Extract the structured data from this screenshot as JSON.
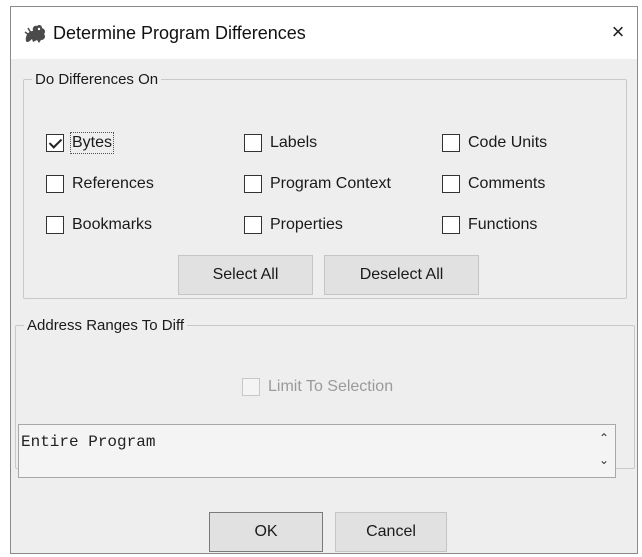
{
  "window": {
    "title": "Determine Program Differences",
    "close_label": "×"
  },
  "diff_group": {
    "legend": "Do Differences On",
    "options": {
      "bytes": {
        "label": "Bytes",
        "checked": true
      },
      "labels": {
        "label": "Labels",
        "checked": false
      },
      "code_units": {
        "label": "Code Units",
        "checked": false
      },
      "references": {
        "label": "References",
        "checked": false
      },
      "program_context": {
        "label": "Program Context",
        "checked": false
      },
      "comments": {
        "label": "Comments",
        "checked": false
      },
      "bookmarks": {
        "label": "Bookmarks",
        "checked": false
      },
      "properties": {
        "label": "Properties",
        "checked": false
      },
      "functions": {
        "label": "Functions",
        "checked": false
      }
    },
    "select_all_label": "Select All",
    "deselect_all_label": "Deselect All"
  },
  "range_group": {
    "legend": "Address Ranges To Diff",
    "limit_to_selection": {
      "label": "Limit To Selection",
      "checked": false,
      "enabled": false
    },
    "range_value": "Entire Program"
  },
  "footer": {
    "ok_label": "OK",
    "cancel_label": "Cancel"
  },
  "icons": {
    "app": "dragon-icon",
    "close": "close-icon",
    "scroll_up": "chevron-up-icon",
    "scroll_down": "chevron-down-icon"
  }
}
